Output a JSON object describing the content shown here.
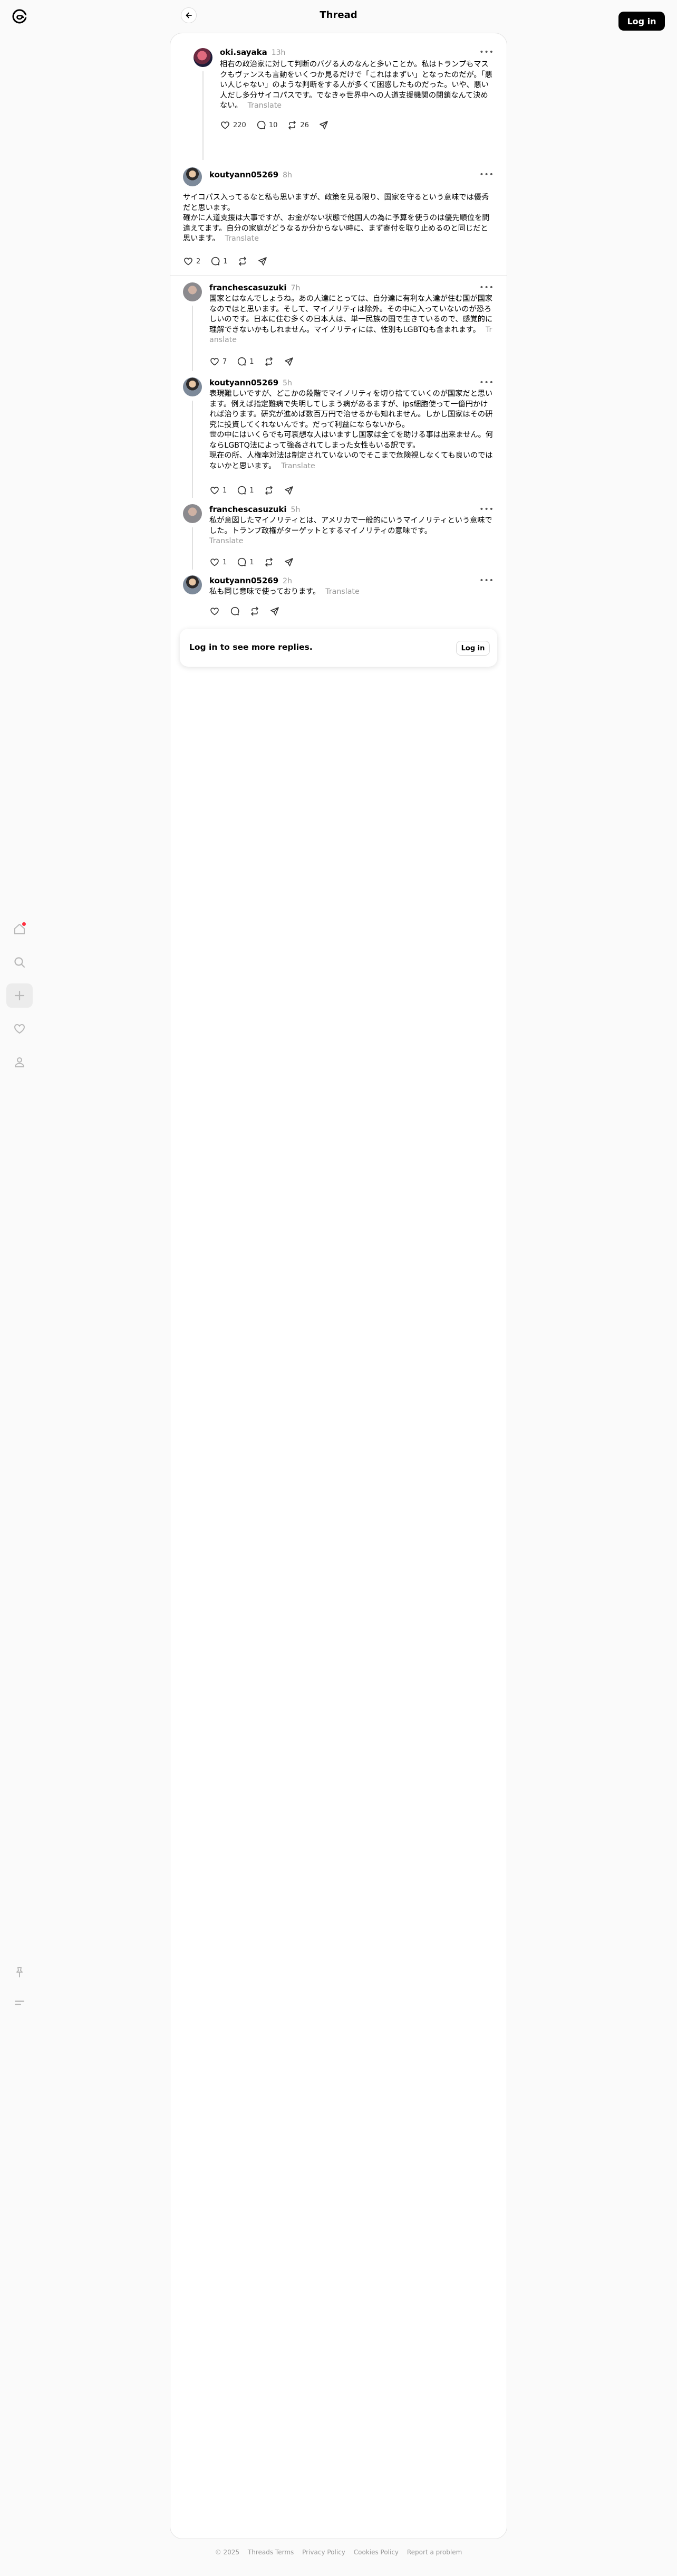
{
  "header": {
    "title": "Thread",
    "login_label": "Log in"
  },
  "posts": [
    {
      "username": "oki.sayaka",
      "time": "13h",
      "text": "相右の政治家に対して判断のバグる人のなんと多いことか。私はトランプもマスクもヴァンスも言動をいくつか見るだけで「これはまずい」となったのだが。「悪い人じゃない」のような判断をする人が多くて困惑したものだった。いや、悪い人だし多分サイコパスです。でなきゃ世界中への人道支援機関の閉鎖なんて決めない。",
      "translate": "Translate",
      "likes": "220",
      "replies": "10",
      "reposts": "26"
    },
    {
      "username": "koutyann05269",
      "time": "8h",
      "text": "サイコパス入ってるなと私も思いますが、政策を見る限り、国家を守るという意味では優秀だと思います。\n確かに人道支援は大事ですが、お金がない状態で他国人の為に予算を使うのは優先順位を間違えてます。自分の家庭がどうなるか分からない時に、まず寄付を取り止めるのと同じだと思います。",
      "translate": "Translate",
      "likes": "2",
      "replies": "1",
      "reposts": ""
    },
    {
      "username": "franchescasuzuki",
      "time": "7h",
      "text": "国家とはなんでしょうね。あの人達にとっては、自分達に有利な人達が住む国が国家なのではと思います。そして、マイノリティは除外。その中に入っていないのが恐ろしいのです。日本に住む多くの日本人は、単一民族の国で生きているので、感覚的に理解できないかもしれません。マイノリティには、性別もLGBTQも含まれます。",
      "translate": "Translate",
      "likes": "7",
      "replies": "1",
      "reposts": ""
    },
    {
      "username": "koutyann05269",
      "time": "5h",
      "text": "表現難しいですが、どこかの段階でマイノリティを切り捨てていくのが国家だと思います。例えば指定難病で失明してしまう病があるますが、ips細胞使って一億円かければ治ります。研究が進めば数百万円で治せるかも知れません。しかし国家はその研究に投資してくれないんです。だって利益にならないから。\n世の中にはいくらでも可哀想な人はいますし国家は全てを助ける事は出来ません。何ならLGBTQ法によって強姦されてしまった女性もいる訳です。\n現在の所、人権率対法は制定されていないのでそこまで危険視しなくても良いのではないかと思います。",
      "translate": "Translate",
      "likes": "1",
      "replies": "1",
      "reposts": ""
    },
    {
      "username": "franchescasuzuki",
      "time": "5h",
      "text": "私が意図したマイノリティとは、アメリカで一般的にいうマイノリティという意味でした。トランプ政権がターゲットとするマイノリティの意味です。",
      "translate": "Translate",
      "likes": "1",
      "replies": "1",
      "reposts": ""
    },
    {
      "username": "koutyann05269",
      "time": "2h",
      "text": "私も同じ意味で使っております。",
      "translate": "Translate",
      "likes": "",
      "replies": "",
      "reposts": ""
    }
  ],
  "login_prompt": {
    "message": "Log in to see more replies.",
    "button": "Log in"
  },
  "footer": {
    "items": [
      "© 2025",
      "Threads Terms",
      "Privacy Policy",
      "Cookies Policy",
      "Report a problem"
    ]
  },
  "icons": {
    "logo": "threads-logo-icon",
    "back": "back-arrow-icon",
    "home": "home-icon",
    "search": "search-icon",
    "create": "plus-icon",
    "activity": "heart-icon",
    "profile": "person-icon",
    "pin": "pin-icon",
    "menu": "menu-icon"
  }
}
